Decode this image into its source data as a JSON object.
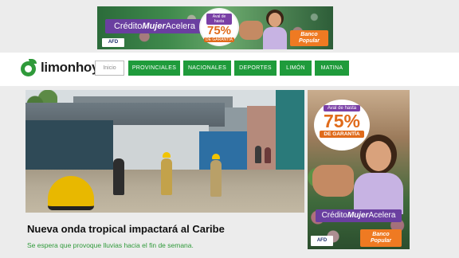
{
  "top_ad": {
    "credit_prefix": "Crédito",
    "credit_emphasis": "Mujer",
    "credit_suffix": "Acelera",
    "badge_top": "Aval de hasta",
    "badge_percent": "75%",
    "badge_bottom": "DE GARANTÍA",
    "afd": "AFD",
    "bank_line1": "Banco",
    "bank_line2": "Popular"
  },
  "header": {
    "logo": "limonhoy",
    "nav": {
      "inicio": "Inicio",
      "items": [
        "PROVINCIALES",
        "NACIONALES",
        "DEPORTES",
        "LIMÓN",
        "MATINA"
      ]
    }
  },
  "main_story": {
    "headline": "Nueva onda tropical impactará al Caribe",
    "summary": "Se espera que provoque lluvias hacia el fin de semana."
  },
  "side_ad": {
    "credit_prefix": "Crédito",
    "credit_emphasis": "Mujer",
    "credit_suffix": "Acelera",
    "badge_top": "Aval de hasta",
    "badge_percent": "75%",
    "badge_bottom": "DE GARANTÍA",
    "afd": "AFD",
    "bank_line1": "Banco",
    "bank_line2": "Popular"
  },
  "colors": {
    "brand_green": "#1f9b3b",
    "ad_purple": "#6a3fa0",
    "ad_orange": "#e06b1b"
  }
}
